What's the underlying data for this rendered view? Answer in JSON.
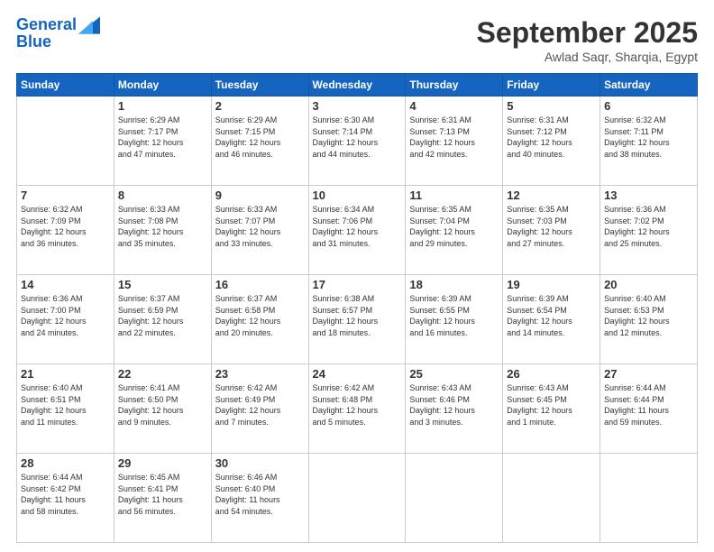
{
  "logo": {
    "line1": "General",
    "line2": "Blue"
  },
  "header": {
    "month": "September 2025",
    "location": "Awlad Saqr, Sharqia, Egypt"
  },
  "weekdays": [
    "Sunday",
    "Monday",
    "Tuesday",
    "Wednesday",
    "Thursday",
    "Friday",
    "Saturday"
  ],
  "weeks": [
    [
      {
        "day": "",
        "info": ""
      },
      {
        "day": "1",
        "info": "Sunrise: 6:29 AM\nSunset: 7:17 PM\nDaylight: 12 hours\nand 47 minutes."
      },
      {
        "day": "2",
        "info": "Sunrise: 6:29 AM\nSunset: 7:15 PM\nDaylight: 12 hours\nand 46 minutes."
      },
      {
        "day": "3",
        "info": "Sunrise: 6:30 AM\nSunset: 7:14 PM\nDaylight: 12 hours\nand 44 minutes."
      },
      {
        "day": "4",
        "info": "Sunrise: 6:31 AM\nSunset: 7:13 PM\nDaylight: 12 hours\nand 42 minutes."
      },
      {
        "day": "5",
        "info": "Sunrise: 6:31 AM\nSunset: 7:12 PM\nDaylight: 12 hours\nand 40 minutes."
      },
      {
        "day": "6",
        "info": "Sunrise: 6:32 AM\nSunset: 7:11 PM\nDaylight: 12 hours\nand 38 minutes."
      }
    ],
    [
      {
        "day": "7",
        "info": "Sunrise: 6:32 AM\nSunset: 7:09 PM\nDaylight: 12 hours\nand 36 minutes."
      },
      {
        "day": "8",
        "info": "Sunrise: 6:33 AM\nSunset: 7:08 PM\nDaylight: 12 hours\nand 35 minutes."
      },
      {
        "day": "9",
        "info": "Sunrise: 6:33 AM\nSunset: 7:07 PM\nDaylight: 12 hours\nand 33 minutes."
      },
      {
        "day": "10",
        "info": "Sunrise: 6:34 AM\nSunset: 7:06 PM\nDaylight: 12 hours\nand 31 minutes."
      },
      {
        "day": "11",
        "info": "Sunrise: 6:35 AM\nSunset: 7:04 PM\nDaylight: 12 hours\nand 29 minutes."
      },
      {
        "day": "12",
        "info": "Sunrise: 6:35 AM\nSunset: 7:03 PM\nDaylight: 12 hours\nand 27 minutes."
      },
      {
        "day": "13",
        "info": "Sunrise: 6:36 AM\nSunset: 7:02 PM\nDaylight: 12 hours\nand 25 minutes."
      }
    ],
    [
      {
        "day": "14",
        "info": "Sunrise: 6:36 AM\nSunset: 7:00 PM\nDaylight: 12 hours\nand 24 minutes."
      },
      {
        "day": "15",
        "info": "Sunrise: 6:37 AM\nSunset: 6:59 PM\nDaylight: 12 hours\nand 22 minutes."
      },
      {
        "day": "16",
        "info": "Sunrise: 6:37 AM\nSunset: 6:58 PM\nDaylight: 12 hours\nand 20 minutes."
      },
      {
        "day": "17",
        "info": "Sunrise: 6:38 AM\nSunset: 6:57 PM\nDaylight: 12 hours\nand 18 minutes."
      },
      {
        "day": "18",
        "info": "Sunrise: 6:39 AM\nSunset: 6:55 PM\nDaylight: 12 hours\nand 16 minutes."
      },
      {
        "day": "19",
        "info": "Sunrise: 6:39 AM\nSunset: 6:54 PM\nDaylight: 12 hours\nand 14 minutes."
      },
      {
        "day": "20",
        "info": "Sunrise: 6:40 AM\nSunset: 6:53 PM\nDaylight: 12 hours\nand 12 minutes."
      }
    ],
    [
      {
        "day": "21",
        "info": "Sunrise: 6:40 AM\nSunset: 6:51 PM\nDaylight: 12 hours\nand 11 minutes."
      },
      {
        "day": "22",
        "info": "Sunrise: 6:41 AM\nSunset: 6:50 PM\nDaylight: 12 hours\nand 9 minutes."
      },
      {
        "day": "23",
        "info": "Sunrise: 6:42 AM\nSunset: 6:49 PM\nDaylight: 12 hours\nand 7 minutes."
      },
      {
        "day": "24",
        "info": "Sunrise: 6:42 AM\nSunset: 6:48 PM\nDaylight: 12 hours\nand 5 minutes."
      },
      {
        "day": "25",
        "info": "Sunrise: 6:43 AM\nSunset: 6:46 PM\nDaylight: 12 hours\nand 3 minutes."
      },
      {
        "day": "26",
        "info": "Sunrise: 6:43 AM\nSunset: 6:45 PM\nDaylight: 12 hours\nand 1 minute."
      },
      {
        "day": "27",
        "info": "Sunrise: 6:44 AM\nSunset: 6:44 PM\nDaylight: 11 hours\nand 59 minutes."
      }
    ],
    [
      {
        "day": "28",
        "info": "Sunrise: 6:44 AM\nSunset: 6:42 PM\nDaylight: 11 hours\nand 58 minutes."
      },
      {
        "day": "29",
        "info": "Sunrise: 6:45 AM\nSunset: 6:41 PM\nDaylight: 11 hours\nand 56 minutes."
      },
      {
        "day": "30",
        "info": "Sunrise: 6:46 AM\nSunset: 6:40 PM\nDaylight: 11 hours\nand 54 minutes."
      },
      {
        "day": "",
        "info": ""
      },
      {
        "day": "",
        "info": ""
      },
      {
        "day": "",
        "info": ""
      },
      {
        "day": "",
        "info": ""
      }
    ]
  ]
}
